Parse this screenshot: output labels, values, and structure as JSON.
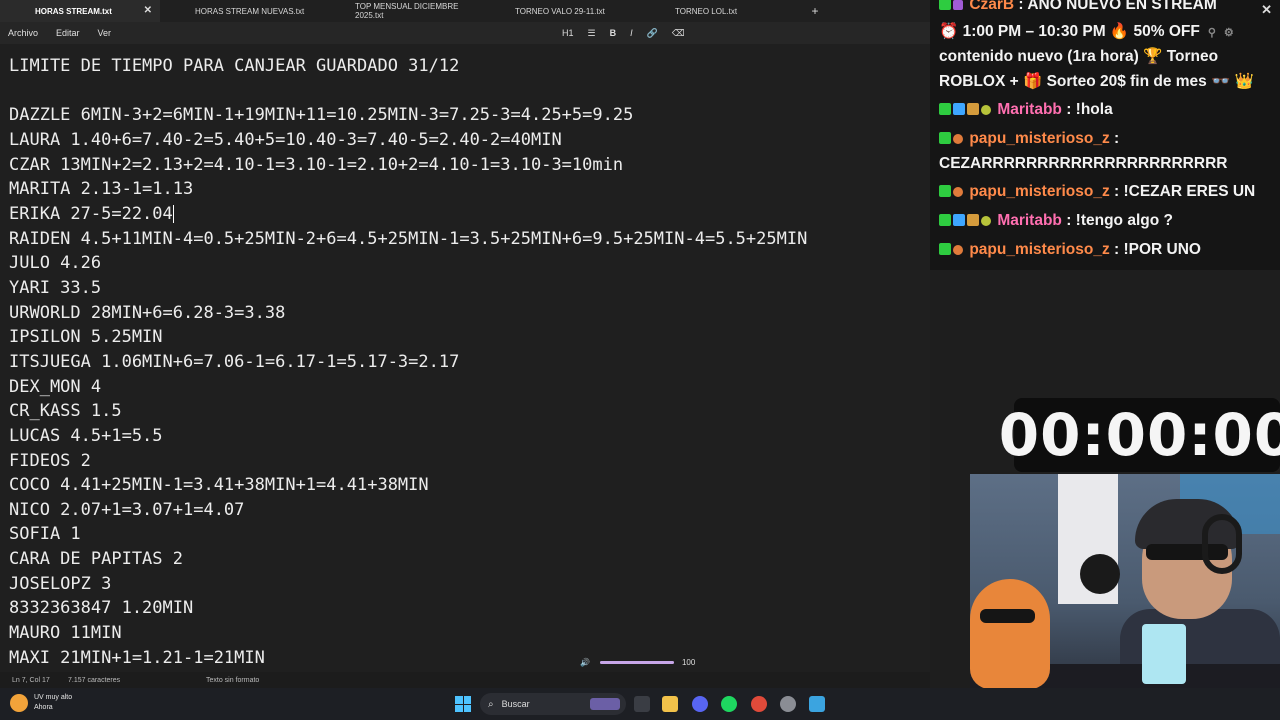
{
  "notepad": {
    "tabs": [
      {
        "label": "HORAS STREAM.txt",
        "active": true
      },
      {
        "label": "HORAS STREAM NUEVAS.txt",
        "active": false
      },
      {
        "label": "TOP MENSUAL DICIEMBRE 2025.txt",
        "active": false
      },
      {
        "label": "TORNEO VALO 29-11.txt",
        "active": false
      },
      {
        "label": "TORNEO LOL.txt",
        "active": false
      }
    ],
    "add_tab": "+",
    "close_glyph": "✕",
    "menu": [
      "Archivo",
      "Editar",
      "Ver"
    ],
    "toolbar": {
      "heading": "H1",
      "list": "☰",
      "bold": "B",
      "italic": "I",
      "link": "🔗",
      "clear": "⌫"
    },
    "lines": [
      "LIMITE DE TIEMPO PARA CANJEAR GUARDADO 31/12",
      "",
      "DAZZLE 6MIN-3+2=6MIN-1+19MIN+11=10.25MIN-3=7.25-3=4.25+5=9.25",
      "LAURA 1.40+6=7.40-2=5.40+5=10.40-3=7.40-5=2.40-2=40MIN",
      "CZAR 13MIN+2=2.13+2=4.10-1=3.10-1=2.10+2=4.10-1=3.10-3=10min",
      "MARITA 2.13-1=1.13",
      "ERIKA 27-5=22.04",
      "RAIDEN 4.5+11MIN-4=0.5+25MIN-2+6=4.5+25MIN-1=3.5+25MIN+6=9.5+25MIN-4=5.5+25MIN",
      "JULO 4.26",
      "YARI 33.5",
      "URWORLD 28MIN+6=6.28-3=3.38",
      "IPSILON 5.25MIN",
      "ITSJUEGA 1.06MIN+6=7.06-1=6.17-1=5.17-3=2.17",
      "DEX_MON 4",
      "CR_KASS 1.5",
      "LUCAS 4.5+1=5.5",
      "FIDEOS 2",
      "COCO 4.41+25MIN-1=3.41+38MIN+1=4.41+38MIN",
      "NICO 2.07+1=3.07+1=4.07",
      "SOFIA 1",
      "CARA DE PAPITAS 2",
      "JOSELOPZ 3",
      "8332363847 1.20MIN",
      "MAURO 11MIN",
      "MAXI 21MIN+1=1.21-1=21MIN"
    ],
    "status": {
      "position": "Ln 7, Col 17",
      "chars": "7.157 caracteres",
      "format": "Texto sin formato"
    },
    "volume": {
      "value": "100",
      "level": 1.0
    }
  },
  "chat": {
    "header": {
      "user": "CzarB",
      "sep": " : ",
      "text": "AÑO NUEVO EN STREAM"
    },
    "promo_lines": [
      "⏰ 1:00 PM – 10:30 PM 🔥 50% OFF",
      "contenido nuevo (1ra hora) 🏆 Torneo",
      "ROBLOX + 🎁 Sorteo 20$ fin de mes 👓 👑"
    ],
    "messages": [
      {
        "user": "Maritabb",
        "text": " : !hola"
      },
      {
        "user": "papu_misterioso_z",
        "text": " :"
      },
      {
        "user": "",
        "text": "CEZARRRRRRRRRRRRRRRRRRRRRR"
      },
      {
        "user": "papu_misterioso_z",
        "text": " : !CEZAR ERES UN"
      },
      {
        "user": "Maritabb",
        "text": " : !tengo algo ?"
      },
      {
        "user": "papu_misterioso_z",
        "text": " : !POR UNO"
      }
    ]
  },
  "timer": {
    "value": "00:00:00"
  },
  "taskbar": {
    "weather_title": "UV muy alto",
    "weather_sub": "Ahora",
    "search_placeholder": "Buscar"
  }
}
